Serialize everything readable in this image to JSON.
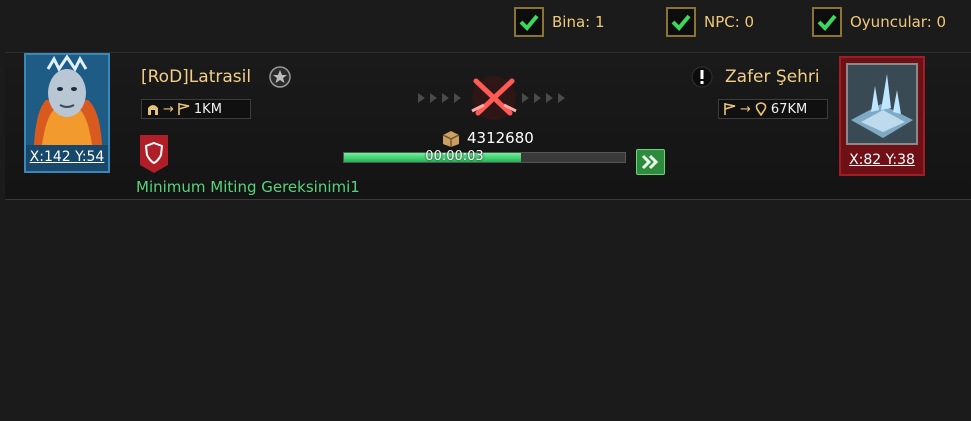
{
  "filters": [
    {
      "label": "Bina: 1",
      "checked": true
    },
    {
      "label": "NPC: 0",
      "checked": true
    },
    {
      "label": "Oyuncular: 0",
      "checked": true
    }
  ],
  "attacker": {
    "name": "[RoD]Latrasil",
    "coords": "X:142 Y:54",
    "distance": "1KM"
  },
  "target": {
    "name": "Zafer Şehri",
    "coords": "X:82 Y:38",
    "distance": "67KM"
  },
  "march": {
    "load": "4312680",
    "timer": "00:00:03",
    "progress": 0.63
  },
  "rally_requirement": "Minimum Miting Gereksinimi1",
  "colors": {
    "accent_gold": "#f2cf88",
    "progress_green": "#33c463",
    "requirement_green": "#56d37a",
    "crossed_swords_red": "#e0413f"
  }
}
